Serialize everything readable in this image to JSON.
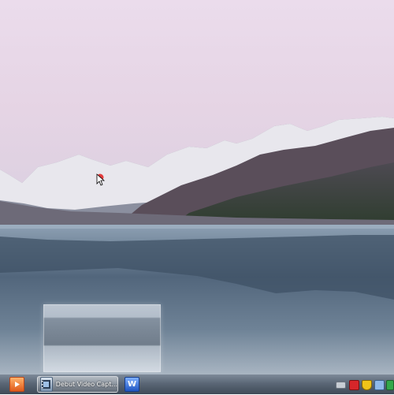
{
  "desktop": {
    "wallpaper": "Lake and snowy mountain range at dusk"
  },
  "taskbar": {
    "buttons": [
      {
        "icon": "media-player-icon",
        "label": ""
      },
      {
        "icon": "film-icon",
        "label": "Debut Video Capt..."
      },
      {
        "icon": "word-icon",
        "glyph": "W",
        "label": ""
      }
    ],
    "tray_icons": [
      "network-icon",
      "alert-icon",
      "shield-icon",
      "monitor-icon",
      "flag-icon"
    ]
  },
  "colors": {
    "sky_top": "#e9dcec",
    "mountain_snow": "#ffffff",
    "water": "#5d7186",
    "taskbar": "#5b6776"
  }
}
